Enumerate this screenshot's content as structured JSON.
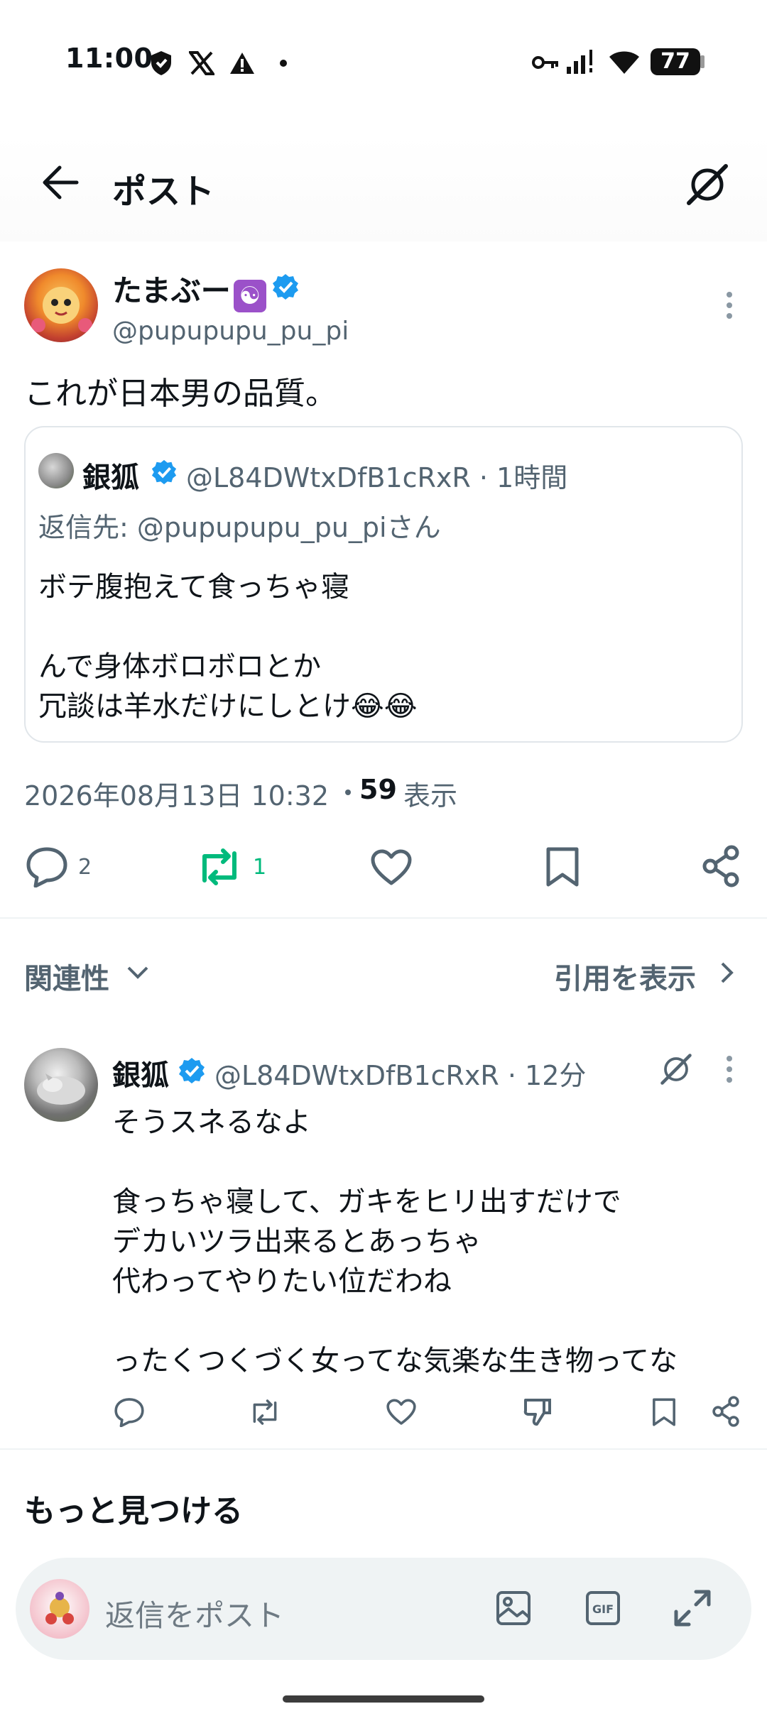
{
  "status_bar": {
    "time": "11:00",
    "battery": "77"
  },
  "header": {
    "title": "ポスト"
  },
  "post": {
    "author_name": "たまぶー",
    "author_emoji": "☯",
    "author_handle": "@pupupupu_pu_pi",
    "text": "これが日本男の品質。",
    "timestamp": "2026年08月13日 10:32",
    "views_count": "59",
    "views_label": "表示",
    "reply_count": "2",
    "repost_count": "1"
  },
  "quote": {
    "author_name": "銀狐",
    "meta": "@L84DWtxDfB1cRxR · 1時間",
    "reply_to": "返信先: @pupupupu_pu_piさん",
    "lines": [
      "ボテ腹抱えて食っちゃ寝",
      "",
      "んで身体ボロボロとか",
      "冗談は羊水だけにしとけ😂😂"
    ]
  },
  "sort": {
    "label": "関連性",
    "quotes_link": "引用を表示"
  },
  "reply": {
    "author_name": "銀狐",
    "meta": "@L84DWtxDfB1cRxR · 12分",
    "lines": [
      "そうスネるなよ",
      "",
      "食っちゃ寝して、ガキをヒリ出すだけで",
      "デカいツラ出来るとあっちゃ",
      "代わってやりたい位だわね",
      "",
      "ったくつくづく女ってな気楽な生き物ってな"
    ]
  },
  "discover": {
    "title": "もっと見つける"
  },
  "composer": {
    "placeholder": "返信をポスト"
  },
  "colors": {
    "repost_green": "#00ba7c",
    "verified_blue": "#1d9bf0",
    "muted": "#536471"
  },
  "icons": [
    "back-arrow-icon",
    "grok-icon",
    "more-icon",
    "reply-icon",
    "repost-icon",
    "like-icon",
    "bookmark-icon",
    "share-icon",
    "dislike-icon",
    "image-icon",
    "gif-icon",
    "expand-icon"
  ]
}
